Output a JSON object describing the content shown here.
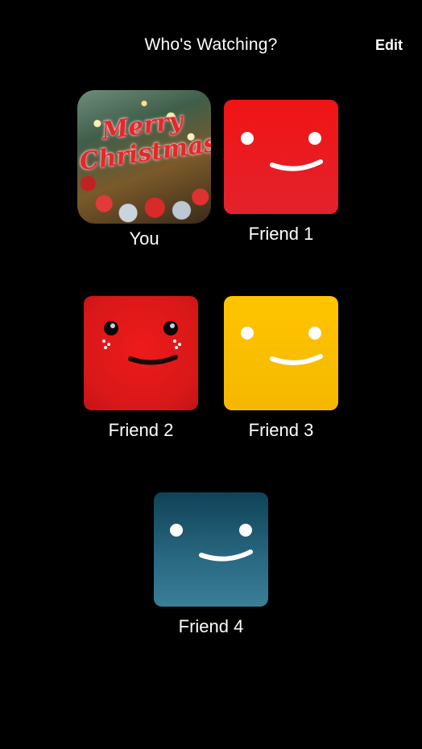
{
  "header": {
    "title": "Who's Watching?",
    "edit_label": "Edit"
  },
  "profiles": [
    {
      "name": "You",
      "avatar": "merry-christmas-image",
      "avatar_text": "Merry Christmas"
    },
    {
      "name": "Friend 1",
      "avatar": "smiley-red",
      "color": "#f01414"
    },
    {
      "name": "Friend 2",
      "avatar": "smiley-red-teary",
      "color": "#e31818"
    },
    {
      "name": "Friend 3",
      "avatar": "smiley-yellow",
      "color": "#ffc400"
    },
    {
      "name": "Friend 4",
      "avatar": "smiley-teal",
      "color": "#1f5a73"
    }
  ]
}
